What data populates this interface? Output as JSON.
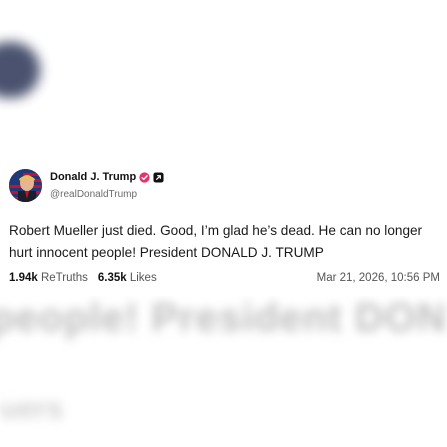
{
  "post": {
    "display_name": "Donald J. Trump",
    "handle": "@realDonaldTrump",
    "text": "Robert Mueller just died. Good, I’m glad he’s dead. He can no longer hurt innocent people! President DONALD J. TRUMP",
    "retruths_count": "1.94k",
    "retruths_label": "ReTruths",
    "likes_count": "6.35k",
    "likes_label": "Likes",
    "timestamp": "Mar 21, 2026, 10:56 PM"
  },
  "background": {
    "blurred_line1": "people! President DON",
    "blurred_line2": "uers"
  },
  "icons": {
    "verified": "verified-check-icon",
    "badge": "arrow-badge-icon",
    "avatar": "flag-portrait-avatar"
  },
  "colors": {
    "verified": "#e8326b",
    "badge": "#111111",
    "text": "#1a1a1a",
    "muted": "#6b6b6b"
  }
}
